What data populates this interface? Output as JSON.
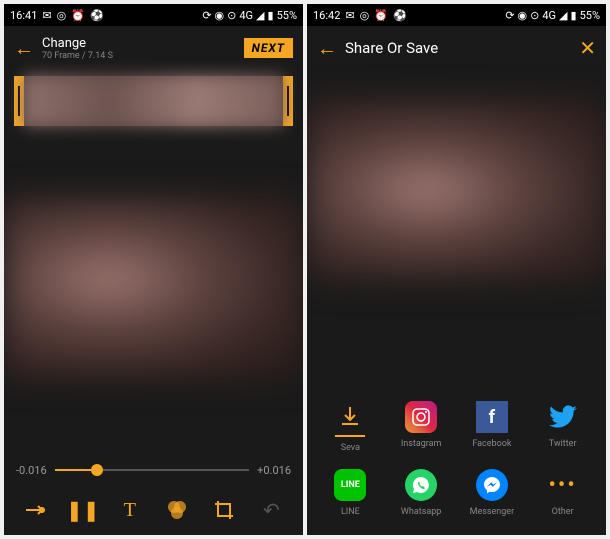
{
  "left": {
    "status": {
      "time": "16:41",
      "network": "4G",
      "battery": "55%"
    },
    "header": {
      "title": "Change",
      "sub": "70 Frame / 7.14 S",
      "next": "NEXT"
    },
    "slider": {
      "min": "-0.016",
      "max": "+0.016"
    }
  },
  "right": {
    "status": {
      "time": "16:42",
      "network": "4G",
      "battery": "55%"
    },
    "header": {
      "title": "Share Or Save"
    },
    "share": [
      {
        "id": "save",
        "label": "Seva"
      },
      {
        "id": "instagram",
        "label": "Instagram"
      },
      {
        "id": "facebook",
        "label": "Facebook"
      },
      {
        "id": "twitter",
        "label": "Twitter"
      },
      {
        "id": "line",
        "label": "LINE"
      },
      {
        "id": "whatsapp",
        "label": "Whatsapp"
      },
      {
        "id": "messenger",
        "label": "Messenger"
      },
      {
        "id": "other",
        "label": "Other"
      }
    ]
  }
}
